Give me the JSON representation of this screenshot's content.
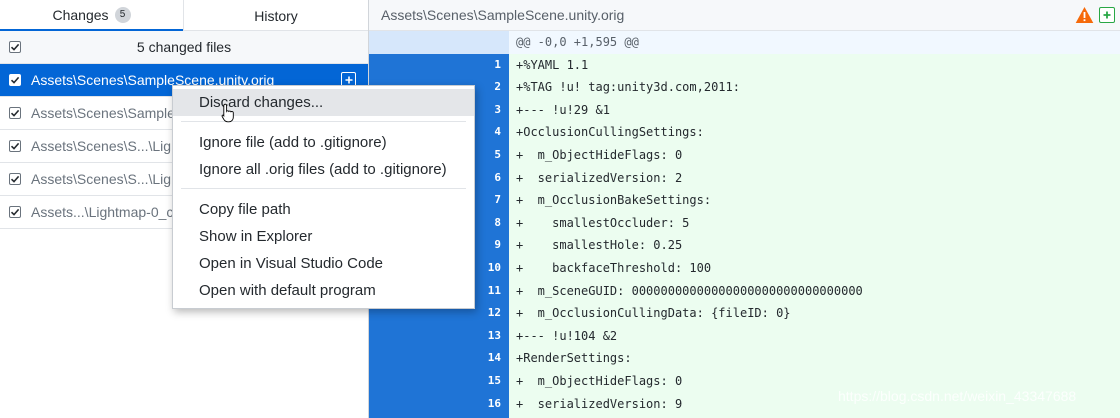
{
  "tabs": {
    "changes_label": "Changes",
    "changes_count": "5",
    "history_label": "History"
  },
  "changes_header": {
    "label": "5 changed files",
    "checked": true
  },
  "files": [
    {
      "name": "Assets\\Scenes\\SampleScene.unity.orig",
      "selected": true,
      "checked": true
    },
    {
      "name": "Assets\\Scenes\\SampleS",
      "selected": false,
      "checked": true
    },
    {
      "name": "Assets\\Scenes\\S...\\Light",
      "selected": false,
      "checked": true
    },
    {
      "name": "Assets\\Scenes\\S...\\Light",
      "selected": false,
      "checked": true
    },
    {
      "name": "Assets...\\Lightmap-0_co",
      "selected": false,
      "checked": true
    }
  ],
  "diff_header": {
    "path": "Assets\\Scenes\\SampleScene.unity.orig",
    "warning_icon": "warning-icon",
    "status_icon": "file-added-icon"
  },
  "diff": {
    "hunk": "@@ -0,0 +1,595 @@",
    "lines": [
      {
        "n": "1",
        "text": "+%YAML 1.1"
      },
      {
        "n": "2",
        "text": "+%TAG !u! tag:unity3d.com,2011:"
      },
      {
        "n": "3",
        "text": "+--- !u!29 &1"
      },
      {
        "n": "4",
        "text": "+OcclusionCullingSettings:"
      },
      {
        "n": "5",
        "text": "+  m_ObjectHideFlags: 0"
      },
      {
        "n": "6",
        "text": "+  serializedVersion: 2"
      },
      {
        "n": "7",
        "text": "+  m_OcclusionBakeSettings:"
      },
      {
        "n": "8",
        "text": "+    smallestOccluder: 5"
      },
      {
        "n": "9",
        "text": "+    smallestHole: 0.25"
      },
      {
        "n": "10",
        "text": "+    backfaceThreshold: 100"
      },
      {
        "n": "11",
        "text": "+  m_SceneGUID: 00000000000000000000000000000000"
      },
      {
        "n": "12",
        "text": "+  m_OcclusionCullingData: {fileID: 0}"
      },
      {
        "n": "13",
        "text": "+--- !u!104 &2"
      },
      {
        "n": "14",
        "text": "+RenderSettings:"
      },
      {
        "n": "15",
        "text": "+  m_ObjectHideFlags: 0"
      },
      {
        "n": "16",
        "text": "+  serializedVersion: 9"
      }
    ]
  },
  "context_menu": {
    "items": [
      {
        "label": "Discard changes...",
        "hover": true
      },
      {
        "label": "Ignore file (add to .gitignore)"
      },
      {
        "label": "Ignore all .orig files (add to .gitignore)"
      },
      {
        "label": "Copy file path"
      },
      {
        "label": "Show in Explorer"
      },
      {
        "label": "Open in Visual Studio Code"
      },
      {
        "label": "Open with default program"
      }
    ]
  },
  "watermark": "https://blog.csdn.net/weixin_43347688",
  "colors": {
    "accent": "#0366d6",
    "gutter": "#1f74d6",
    "added_bg": "#ecfdf0",
    "warning": "#f66a0a",
    "added_icon": "#28a745"
  }
}
